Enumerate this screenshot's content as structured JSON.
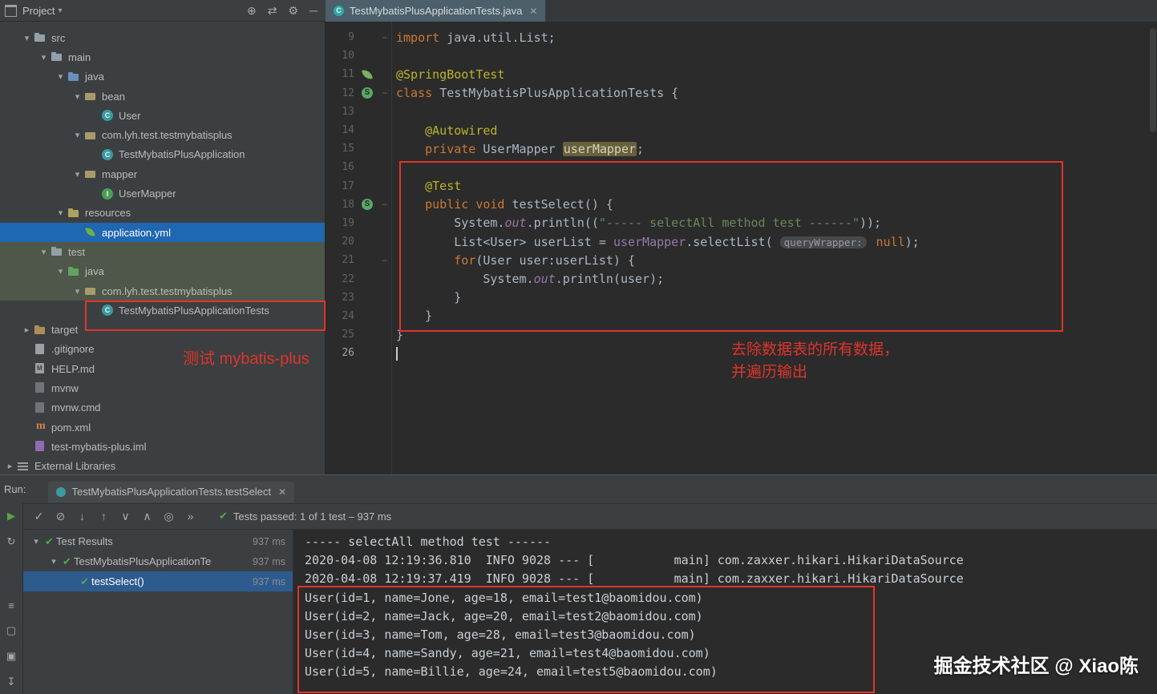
{
  "titlebar": {
    "project_label": "Project",
    "icons": [
      {
        "name": "locate-file-icon",
        "glyph": "⊕"
      },
      {
        "name": "compare-icon",
        "glyph": "⇄"
      },
      {
        "name": "settings-gear-icon",
        "glyph": "⚙"
      },
      {
        "name": "hide-panel-icon",
        "glyph": "─"
      }
    ]
  },
  "editor": {
    "tab_title": "TestMybatisPlusApplicationTests.java",
    "annotations": {
      "line1": "去除数据表的所有数据，",
      "line2": "并遍历输出"
    },
    "code_lines": [
      {
        "num": "9",
        "fold": "-",
        "tokens": [
          {
            "t": "import",
            "c": "kw"
          },
          {
            "t": " java.util.List;",
            "c": "pl"
          }
        ]
      },
      {
        "num": "10",
        "tokens": []
      },
      {
        "num": "11",
        "gutter": "leaf",
        "tokens": [
          {
            "t": "@SpringBootTest",
            "c": "ann"
          }
        ]
      },
      {
        "num": "12",
        "gutter": "bean",
        "fold": "-",
        "tokens": [
          {
            "t": "class ",
            "c": "kw"
          },
          {
            "t": "TestMybatisPlusApplicationTests {",
            "c": "pl"
          }
        ]
      },
      {
        "num": "13",
        "tokens": []
      },
      {
        "num": "14",
        "tokens": [
          {
            "t": "    ",
            "c": "pl"
          },
          {
            "t": "@Autowired",
            "c": "ann"
          }
        ]
      },
      {
        "num": "15",
        "tokens": [
          {
            "t": "    ",
            "c": "pl"
          },
          {
            "t": "private ",
            "c": "kw"
          },
          {
            "t": "UserMapper ",
            "c": "pl"
          },
          {
            "t": "userMapper",
            "c": "hl"
          },
          {
            "t": ";",
            "c": "pl"
          }
        ]
      },
      {
        "num": "16",
        "tokens": []
      },
      {
        "num": "17",
        "tokens": [
          {
            "t": "    ",
            "c": "pl"
          },
          {
            "t": "@Test",
            "c": "ann"
          }
        ]
      },
      {
        "num": "18",
        "gutter": "bean",
        "fold": "-",
        "tokens": [
          {
            "t": "    ",
            "c": "pl"
          },
          {
            "t": "public void ",
            "c": "kw"
          },
          {
            "t": "testSelect() {",
            "c": "pl"
          }
        ]
      },
      {
        "num": "19",
        "tokens": [
          {
            "t": "        System.",
            "c": "pl"
          },
          {
            "t": "out",
            "c": "fldi"
          },
          {
            "t": ".println((",
            "c": "pl"
          },
          {
            "t": "\"----- selectAll method test ------\"",
            "c": "str"
          },
          {
            "t": "));",
            "c": "pl"
          }
        ]
      },
      {
        "num": "20",
        "tokens": [
          {
            "t": "        List<User> userList = ",
            "c": "pl"
          },
          {
            "t": "userMapper",
            "c": "fld"
          },
          {
            "t": ".selectList( ",
            "c": "pl"
          },
          {
            "t": "queryWrapper:",
            "c": "hint"
          },
          {
            "t": " ",
            "c": "pl"
          },
          {
            "t": "null",
            "c": "kw"
          },
          {
            "t": ");",
            "c": "pl"
          }
        ]
      },
      {
        "num": "21",
        "fold": "-",
        "tokens": [
          {
            "t": "        ",
            "c": "pl"
          },
          {
            "t": "for",
            "c": "kw"
          },
          {
            "t": "(User user:userList) {",
            "c": "pl"
          }
        ]
      },
      {
        "num": "22",
        "tokens": [
          {
            "t": "            System.",
            "c": "pl"
          },
          {
            "t": "out",
            "c": "fldi"
          },
          {
            "t": ".println(user);",
            "c": "pl"
          }
        ]
      },
      {
        "num": "23",
        "tokens": [
          {
            "t": "        }",
            "c": "pl"
          }
        ]
      },
      {
        "num": "24",
        "tokens": [
          {
            "t": "    }",
            "c": "pl"
          }
        ]
      },
      {
        "num": "25",
        "tokens": [
          {
            "t": "}",
            "c": "pl"
          }
        ]
      },
      {
        "num": "26",
        "caret": true,
        "tokens": []
      }
    ]
  },
  "project_tree": {
    "annotation": "测试 mybatis-plus",
    "items": [
      {
        "label": "src",
        "depth": 1,
        "arrow": "down",
        "icon": "folder"
      },
      {
        "label": "main",
        "depth": 2,
        "arrow": "down",
        "icon": "folder"
      },
      {
        "label": "java",
        "depth": 3,
        "arrow": "down",
        "icon": "folder-src"
      },
      {
        "label": "bean",
        "depth": 4,
        "arrow": "down",
        "icon": "package"
      },
      {
        "label": "User",
        "depth": 5,
        "arrow": null,
        "icon": "class"
      },
      {
        "label": "com.lyh.test.testmybatisplus",
        "depth": 4,
        "arrow": "down",
        "icon": "package"
      },
      {
        "label": "TestMybatisPlusApplication",
        "depth": 5,
        "arrow": null,
        "icon": "class"
      },
      {
        "label": "mapper",
        "depth": 4,
        "arrow": "down",
        "icon": "package"
      },
      {
        "label": "UserMapper",
        "depth": 5,
        "arrow": null,
        "icon": "interface"
      },
      {
        "label": "resources",
        "depth": 3,
        "arrow": "down",
        "icon": "folder-res"
      },
      {
        "label": "application.yml",
        "depth": 4,
        "arrow": null,
        "icon": "yml",
        "highlight": "blue"
      },
      {
        "label": "test",
        "depth": 2,
        "arrow": "down",
        "icon": "folder",
        "highlight": "green"
      },
      {
        "label": "java",
        "depth": 3,
        "arrow": "down",
        "icon": "folder-test",
        "highlight": "green"
      },
      {
        "label": "com.lyh.test.testmybatisplus",
        "depth": 4,
        "arrow": "down",
        "icon": "package",
        "highlight": "green"
      },
      {
        "label": "TestMybatisPlusApplicationTests",
        "depth": 5,
        "arrow": null,
        "icon": "class"
      },
      {
        "label": "target",
        "depth": 1,
        "arrow": "right",
        "icon": "folder-excl"
      },
      {
        "label": ".gitignore",
        "depth": 1,
        "arrow": null,
        "icon": "git"
      },
      {
        "label": "HELP.md",
        "depth": 1,
        "arrow": null,
        "icon": "md"
      },
      {
        "label": "mvnw",
        "depth": 1,
        "arrow": null,
        "icon": "sh"
      },
      {
        "label": "mvnw.cmd",
        "depth": 1,
        "arrow": null,
        "icon": "cmd"
      },
      {
        "label": "pom.xml",
        "depth": 1,
        "arrow": null,
        "icon": "maven"
      },
      {
        "label": "test-mybatis-plus.iml",
        "depth": 1,
        "arrow": null,
        "icon": "iml"
      },
      {
        "label": "External Libraries",
        "depth": 0,
        "arrow": "right",
        "icon": "lib"
      }
    ]
  },
  "run": {
    "label": "Run:",
    "tab_title": "TestMybatisPlusApplicationTests.testSelect",
    "status": "Tests passed: 1 of 1 test – 937 ms",
    "toolbar_icons": [
      {
        "name": "show-passed-icon",
        "glyph": "✓"
      },
      {
        "name": "show-ignored-icon",
        "glyph": "⊘"
      },
      {
        "name": "sort-alphabetically-icon",
        "glyph": "↓"
      },
      {
        "name": "sort-by-duration-icon",
        "glyph": "↑"
      },
      {
        "name": "expand-all-icon",
        "glyph": "∨"
      },
      {
        "name": "collapse-all-icon",
        "glyph": "∧"
      },
      {
        "name": "test-history-icon",
        "glyph": "◎"
      },
      {
        "name": "more-options-icon",
        "glyph": "»"
      }
    ],
    "left_icons": [
      {
        "name": "rerun-test-icon",
        "glyph": "▶",
        "cls": "green"
      },
      {
        "name": "rerun-failed-icon",
        "glyph": "↻"
      },
      {
        "name": "auto-test-icon",
        "glyph": "≡"
      },
      {
        "name": "pin-tab-icon",
        "glyph": "▢"
      },
      {
        "name": "scroll-to-end-icon",
        "glyph": "▣"
      },
      {
        "name": "export-results-icon",
        "glyph": "↧"
      }
    ],
    "test_tree": [
      {
        "label": "Test Results",
        "time": "937 ms",
        "arrow": "down",
        "indent": 0
      },
      {
        "label": "TestMybatisPlusApplicationTe",
        "time": "937 ms",
        "arrow": "down",
        "indent": 1
      },
      {
        "label": "testSelect()",
        "time": "937 ms",
        "arrow": null,
        "indent": 2,
        "selected": true
      }
    ],
    "console_lines": [
      "----- selectAll method test ------",
      "2020-04-08 12:19:36.810  INFO 9028 --- [           main] com.zaxxer.hikari.HikariDataSource",
      "2020-04-08 12:19:37.419  INFO 9028 --- [           main] com.zaxxer.hikari.HikariDataSource",
      "User(id=1, name=Jone, age=18, email=test1@baomidou.com)",
      "User(id=2, name=Jack, age=20, email=test2@baomidou.com)",
      "User(id=3, name=Tom, age=28, email=test3@baomidou.com)",
      "User(id=4, name=Sandy, age=21, email=test4@baomidou.com)",
      "User(id=5, name=Billie, age=24, email=test5@baomidou.com)"
    ]
  },
  "watermark": "掘金技术社区 @ Xiao陈",
  "colors": {
    "annotation_red": "#e0342b",
    "selection_blue": "#1f67b0",
    "test_row_green": "#4e5749",
    "spring_green": "#6db33f"
  }
}
